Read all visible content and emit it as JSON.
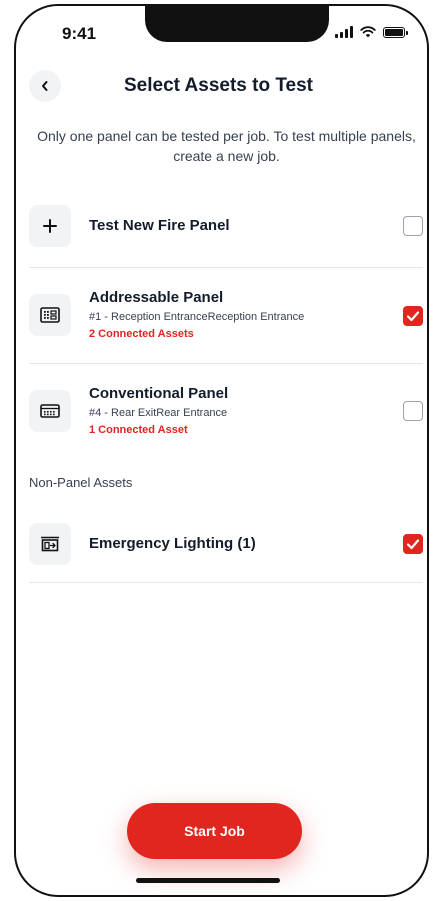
{
  "status_bar": {
    "time": "9:41"
  },
  "header": {
    "title": "Select Assets to Test"
  },
  "subtitle": "Only one panel can be tested per job. To test multiple panels, create a new job.",
  "new_panel": {
    "label": "Test New Fire Panel",
    "icon": "plus-icon",
    "checked": false
  },
  "panels": [
    {
      "title": "Addressable Panel",
      "location": "#1 - Reception EntranceReception Entrance",
      "connected": "2 Connected Assets",
      "icon": "addressable-panel-icon",
      "checked": true
    },
    {
      "title": "Conventional Panel",
      "location": "#4 - Rear ExitRear Entrance",
      "connected": "1 Connected Asset",
      "icon": "conventional-panel-icon",
      "checked": false
    }
  ],
  "non_panel": {
    "section_label": "Non-Panel Assets",
    "items": [
      {
        "title": "Emergency Lighting (1)",
        "icon": "emergency-lighting-icon",
        "checked": true
      }
    ]
  },
  "footer": {
    "start_label": "Start Job"
  },
  "colors": {
    "accent": "#e0261f",
    "text": "#141c2c",
    "muted": "#374151",
    "icon_bg": "#f1f3f5"
  }
}
